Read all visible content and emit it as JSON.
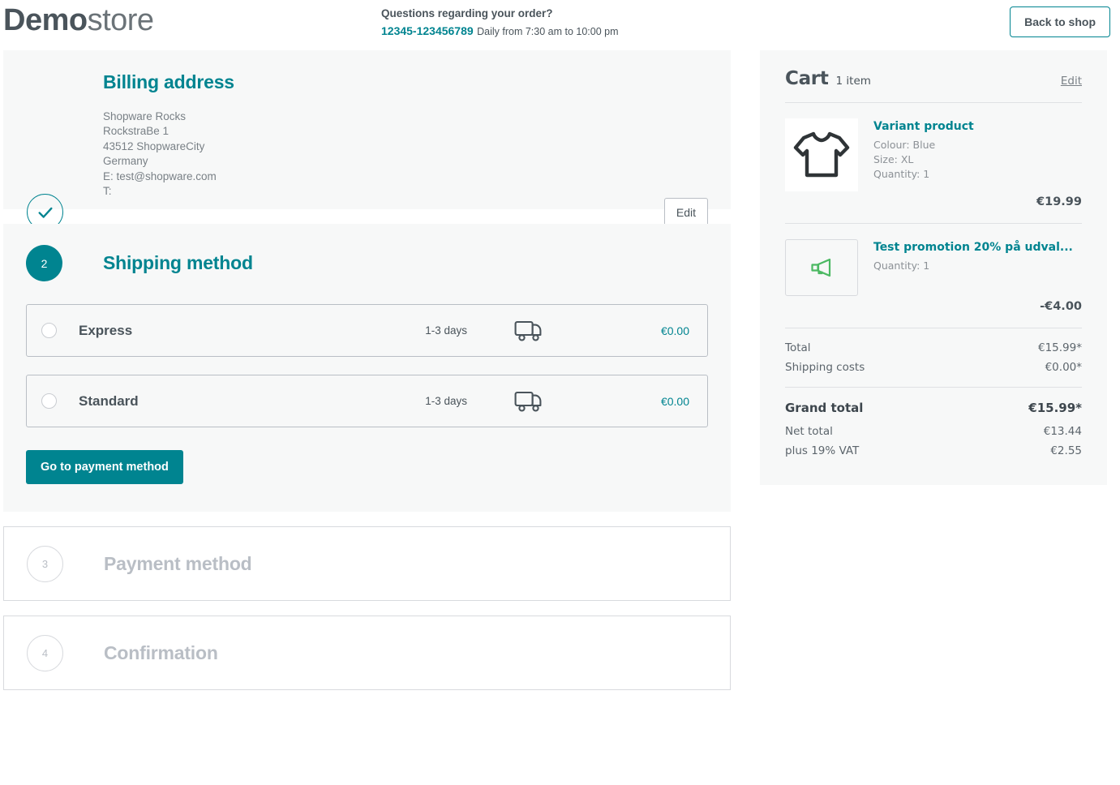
{
  "header": {
    "logo_bold": "Demo",
    "logo_light": "store",
    "question": "Questions regarding your order?",
    "phone": "12345-123456789",
    "hours": "Daily from 7:30 am to 10:00 pm",
    "back_to_shop": "Back to shop"
  },
  "billing": {
    "title": "Billing address",
    "status_icon": "check-icon",
    "lines": [
      "Shopware Rocks",
      "RockstraBe 1",
      "43512 ShopwareCity",
      "Germany",
      "E: test@shopware.com",
      "T:"
    ],
    "edit_label": "Edit"
  },
  "shipping": {
    "step_number": "2",
    "title": "Shipping method",
    "options": [
      {
        "name": "Express",
        "delivery_time": "1-3 days",
        "icon": "truck-icon",
        "price": "€0.00",
        "selected": false
      },
      {
        "name": "Standard",
        "delivery_time": "1-3 days",
        "icon": "truck-icon",
        "price": "€0.00",
        "selected": false
      }
    ],
    "submit_label": "Go to payment method"
  },
  "steps_inactive": [
    {
      "number": "3",
      "title": "Payment method"
    },
    {
      "number": "4",
      "title": "Confirmation"
    }
  ],
  "cart": {
    "title": "Cart",
    "item_count": "1 item",
    "edit_label": "Edit",
    "items": [
      {
        "name": "Variant product",
        "icon": "shirt-icon",
        "meta": [
          "Colour: Blue",
          "Size: XL",
          "Quantity: 1"
        ],
        "price": "€19.99"
      },
      {
        "name": "Test promotion 20% på udval...",
        "icon": "megaphone-icon",
        "meta": [
          "Quantity: 1"
        ],
        "price": "-€4.00"
      }
    ],
    "summary": [
      {
        "label": "Total",
        "value": "€15.99*"
      },
      {
        "label": "Shipping costs",
        "value": "€0.00*"
      }
    ],
    "grand_total": {
      "label": "Grand total",
      "value": "€15.99*"
    },
    "tax_rows": [
      {
        "label": "Net total",
        "value": "€13.44"
      },
      {
        "label": "plus 19% VAT",
        "value": "€2.55"
      }
    ]
  },
  "colors": {
    "accent": "#008490",
    "text": "#4a545b",
    "muted": "#8c9196",
    "disabled": "#b9bec5",
    "panel_bg": "#f7f8f8",
    "promo_green": "#4cb963"
  }
}
